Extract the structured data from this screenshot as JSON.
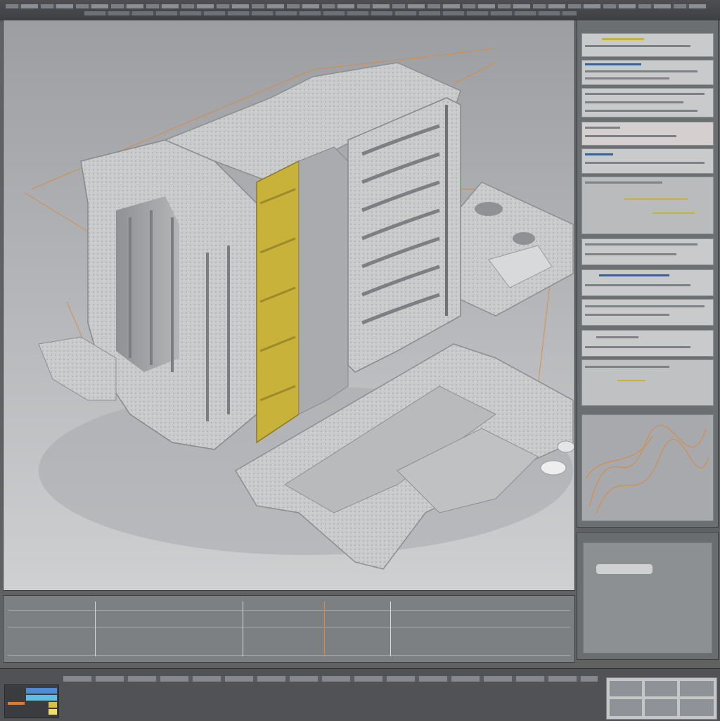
{
  "app": {
    "accent_yellow": "#c9b23a",
    "accent_orange": "#d98a3a",
    "accent_blue": "#3d5f8f"
  },
  "toolbar": {
    "menu_icon": "menu-icon",
    "window_controls": "window-controls-icon"
  },
  "viewport": {
    "model_label": "",
    "gizmo_icon": "axis-gizmo-icon"
  },
  "right_panel": {
    "row_count": 11,
    "graph_icon": "curve-graph-icon"
  },
  "timeline": {
    "playhead_icon": "playhead-icon"
  },
  "bottom_bar": {
    "swatch_colors": [
      "#4a8fd6",
      "#5cc0e6",
      "#d8c23a",
      "#e07a2e",
      "#f0e060"
    ]
  }
}
